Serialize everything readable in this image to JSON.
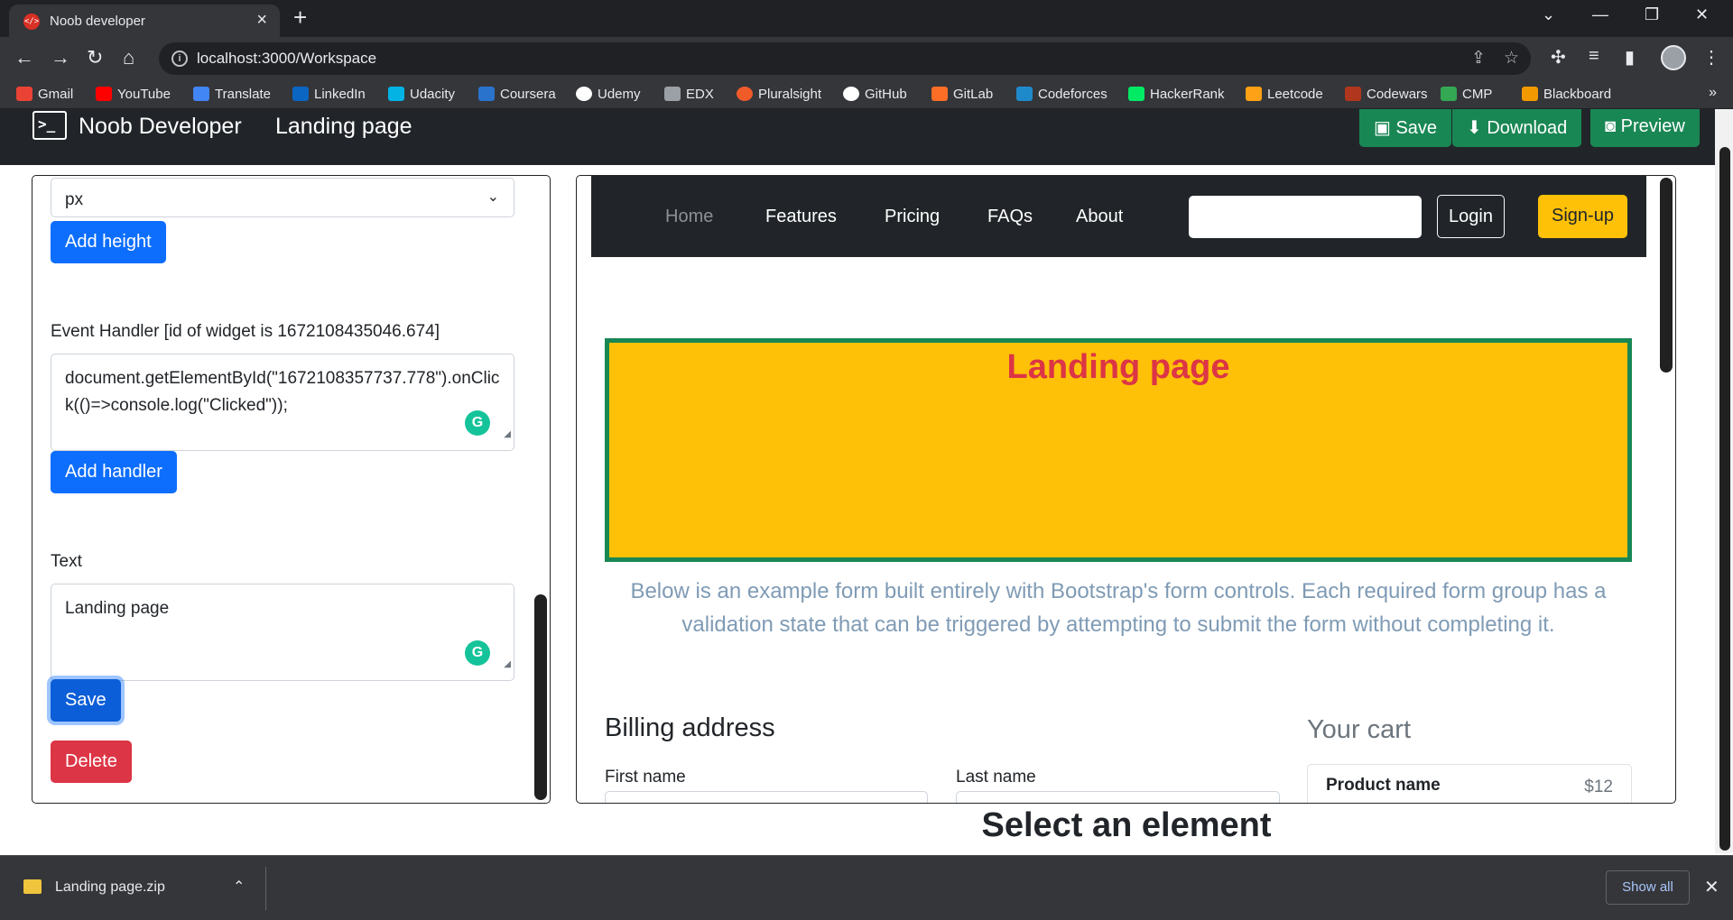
{
  "browser": {
    "tab_title": "Noob developer",
    "url": "localhost:3000/Workspace",
    "bookmarks": [
      {
        "label": "Gmail",
        "icon": "gmail-icon",
        "color": "#ea4335"
      },
      {
        "label": "YouTube",
        "icon": "youtube-icon",
        "color": "#ff0000"
      },
      {
        "label": "Translate",
        "icon": "translate-icon",
        "color": "#4285f4"
      },
      {
        "label": "LinkedIn",
        "icon": "linkedin-icon",
        "color": "#0a66c2"
      },
      {
        "label": "Udacity",
        "icon": "udacity-icon",
        "color": "#02b3e4"
      },
      {
        "label": "Coursera",
        "icon": "coursera-icon",
        "color": "#2a73cc"
      },
      {
        "label": "Udemy",
        "icon": "udemy-icon",
        "color": "#ffffff"
      },
      {
        "label": "EDX",
        "icon": "edx-icon",
        "color": "#9aa0a6"
      },
      {
        "label": "Pluralsight",
        "icon": "pluralsight-icon",
        "color": "#f15b2a"
      },
      {
        "label": "GitHub",
        "icon": "github-icon",
        "color": "#ffffff"
      },
      {
        "label": "GitLab",
        "icon": "gitlab-icon",
        "color": "#fc6d26"
      },
      {
        "label": "Codeforces",
        "icon": "codeforces-icon",
        "color": "#1f8acb"
      },
      {
        "label": "HackerRank",
        "icon": "hackerrank-icon",
        "color": "#00ea64"
      },
      {
        "label": "Leetcode",
        "icon": "leetcode-icon",
        "color": "#ffa116"
      },
      {
        "label": "Codewars",
        "icon": "codewars-icon",
        "color": "#b1361e"
      },
      {
        "label": "CMP",
        "icon": "drive-icon",
        "color": "#34a853"
      },
      {
        "label": "Blackboard",
        "icon": "blackboard-icon",
        "color": "#f29900"
      }
    ]
  },
  "app": {
    "brand": "Noob Developer",
    "page_name": "Landing page",
    "header_buttons": {
      "save": "Save",
      "download": "Download",
      "preview": "Preview"
    }
  },
  "editor": {
    "unit_select": "px",
    "add_height_label": "Add height",
    "event_handler_label": "Event Handler [id of widget is 1672108435046.674]",
    "event_handler_code": "document.getElementById(\"1672108357737.778\").onClick(()=>console.log(\"Clicked\"));",
    "add_handler_label": "Add handler",
    "text_label": "Text",
    "text_value": "Landing page",
    "save_label": "Save",
    "delete_label": "Delete"
  },
  "preview": {
    "nav_links": [
      "Home",
      "Features",
      "Pricing",
      "FAQs",
      "About"
    ],
    "login_label": "Login",
    "signup_label": "Sign-up",
    "hero_title": "Landing page",
    "lead_text": "Below is an example form built entirely with Bootstrap's form controls. Each required form group has a validation state that can be triggered by attempting to submit the form without completing it.",
    "billing_title": "Billing address",
    "first_name_label": "First name",
    "last_name_label": "Last name",
    "cart_title": "Your cart",
    "cart_item": "Product name",
    "cart_price": "$12"
  },
  "select_element_text": "Select an element",
  "downloads": {
    "file_name": "Landing page.zip",
    "show_all_label": "Show all"
  },
  "colors": {
    "primary": "#0d6efd",
    "success": "#198754",
    "danger": "#dc3545",
    "warning": "#ffc107",
    "dark": "#212529"
  }
}
